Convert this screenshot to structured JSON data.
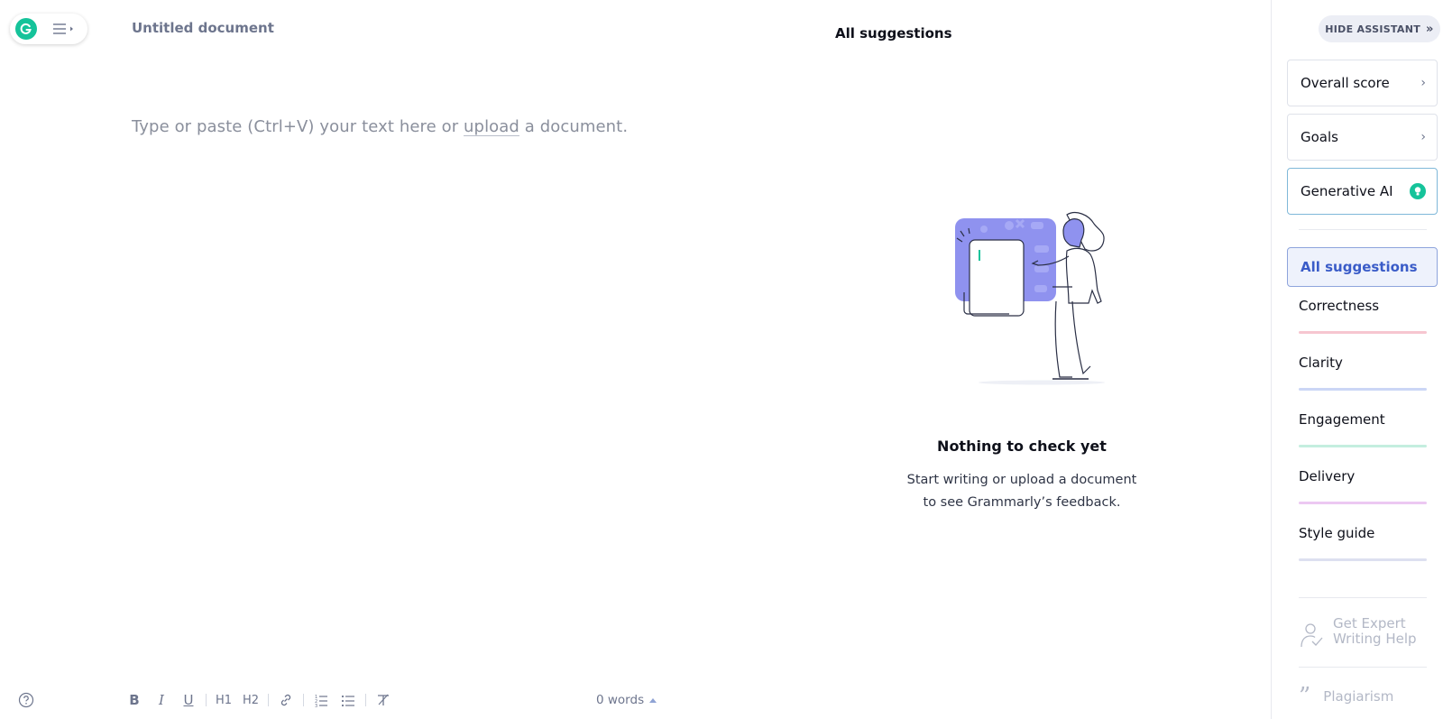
{
  "header": {
    "document_title": "Untitled document",
    "panel_title": "All suggestions"
  },
  "editor": {
    "placeholder_before": "Type or paste (Ctrl+V) your text here or ",
    "placeholder_link": "upload",
    "placeholder_after": " a document."
  },
  "empty_state": {
    "heading": "Nothing to check yet",
    "line1": "Start writing or upload a document",
    "line2": "to see Grammarly’s feedback."
  },
  "toolbar": {
    "bold": "B",
    "italic": "I",
    "underline": "U",
    "h1": "H1",
    "h2": "H2",
    "word_count": "0 words"
  },
  "sidebar": {
    "hide_button": "HIDE ASSISTANT",
    "cards": {
      "overall_score": "Overall score",
      "goals": "Goals",
      "generative_ai": "Generative AI"
    },
    "all_suggestions": "All suggestions",
    "categories": [
      {
        "label": "Correctness",
        "color": "#f6c6d0"
      },
      {
        "label": "Clarity",
        "color": "#cbd6f5"
      },
      {
        "label": "Engagement",
        "color": "#c4eedf"
      },
      {
        "label": "Delivery",
        "color": "#ecc8f2"
      },
      {
        "label": "Style guide",
        "color": "#dde0f0"
      }
    ],
    "expert_help": "Get Expert Writing Help",
    "plagiarism": "Plagiarism"
  },
  "colors": {
    "brand_green": "#15c39a",
    "accent_blue": "#3a5cc8",
    "illustration_purple": "#8f92ef"
  }
}
